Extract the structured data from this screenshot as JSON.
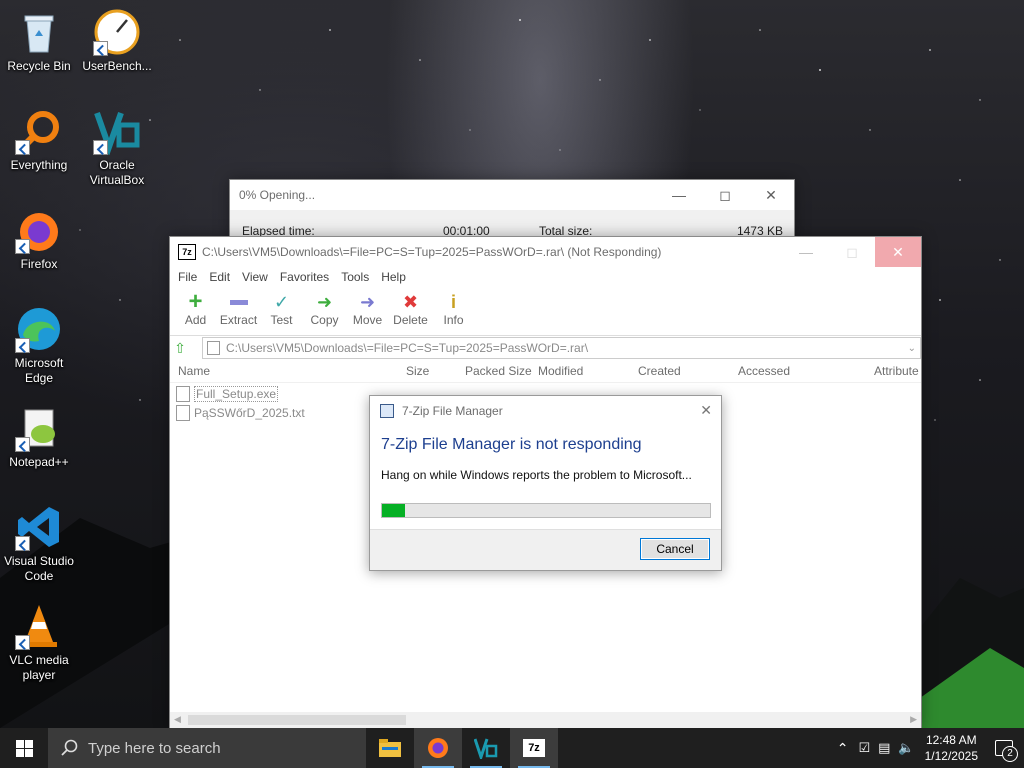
{
  "desktop": {
    "icons": [
      {
        "label": "Recycle Bin"
      },
      {
        "label": "UserBench..."
      },
      {
        "label": "Everything"
      },
      {
        "label": "Oracle VirtualBox"
      },
      {
        "label": "Firefox"
      },
      {
        "label": "Microsoft Edge"
      },
      {
        "label": "Notepad++"
      },
      {
        "label": "Visual Studio Code"
      },
      {
        "label": "VLC media player"
      }
    ]
  },
  "progress_window": {
    "title": "0% Opening...",
    "elapsed_label": "Elapsed time:",
    "elapsed_value": "00:01:00",
    "total_label": "Total size:",
    "total_value": "1473 KB"
  },
  "zip_window": {
    "title": "C:\\Users\\VM5\\Downloads\\=File=PC=S=Tup=2025=PassWOrD=.rar\\ (Not Responding)",
    "menu": [
      "File",
      "Edit",
      "View",
      "Favorites",
      "Tools",
      "Help"
    ],
    "toolbar": [
      {
        "label": "Add",
        "icon": "plus-icon",
        "color": "#3fae3f"
      },
      {
        "label": "Extract",
        "icon": "minus-icon",
        "color": "#7a7ad0"
      },
      {
        "label": "Test",
        "icon": "check-icon",
        "color": "#3fa8a8"
      },
      {
        "label": "Copy",
        "icon": "copy-arrow-icon",
        "color": "#3fae3f"
      },
      {
        "label": "Move",
        "icon": "move-arrow-icon",
        "color": "#7a7ad0"
      },
      {
        "label": "Delete",
        "icon": "x-icon",
        "color": "#e03a3a"
      },
      {
        "label": "Info",
        "icon": "info-icon",
        "color": "#c8a020"
      }
    ],
    "address": "C:\\Users\\VM5\\Downloads\\=File=PC=S=Tup=2025=PassWOrD=.rar\\",
    "columns": [
      "Name",
      "Size",
      "Packed Size",
      "Modified",
      "Created",
      "Accessed",
      "Attribute"
    ],
    "files": [
      {
        "name": "Full_Setup.exe"
      },
      {
        "name": "PąSSWőrD_2025.txt"
      }
    ]
  },
  "dialog": {
    "title": "7-Zip File Manager",
    "heading": "7-Zip File Manager is not responding",
    "message": "Hang on while Windows reports the problem to Microsoft...",
    "progress_percent": 7,
    "cancel_label": "Cancel"
  },
  "taskbar": {
    "search_placeholder": "Type here to search",
    "time": "12:48 AM",
    "date": "1/12/2025",
    "notification_count": "2",
    "apps": [
      "file-explorer-icon",
      "firefox-icon",
      "virtualbox-icon",
      "7zip-icon"
    ]
  },
  "colors": {
    "accent": "#0078d7",
    "progress_green": "#06b025",
    "taskbar": "#1f1f1f",
    "close_hover": "#e81123"
  }
}
